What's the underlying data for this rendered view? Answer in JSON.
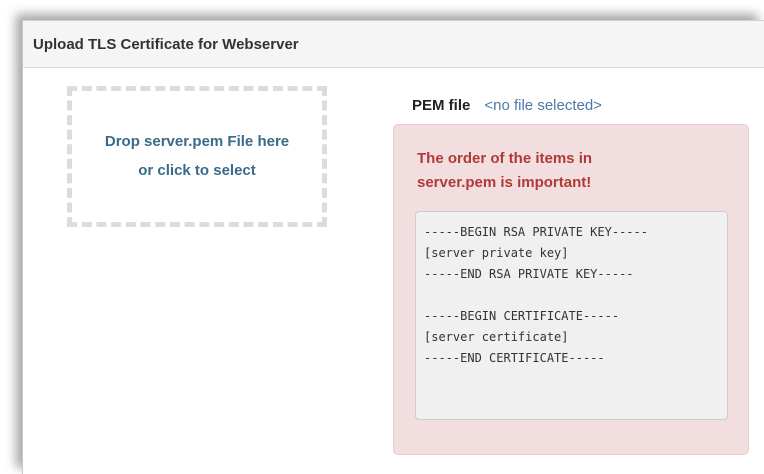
{
  "panel": {
    "title": "Upload TLS Certificate for Webserver"
  },
  "dropzone": {
    "line1": "Drop server.pem File here",
    "line2": "or click to select"
  },
  "pem_file": {
    "label": "PEM file",
    "value": "<no file selected>"
  },
  "alert": {
    "message": "The order of the items in server.pem is important!",
    "code_lines": [
      "-----BEGIN RSA PRIVATE KEY-----",
      "[server private key]",
      "-----END RSA PRIVATE KEY-----",
      "",
      "-----BEGIN CERTIFICATE-----",
      "[server certificate]",
      "-----END CERTIFICATE-----"
    ]
  },
  "colors": {
    "alert_background": "#f2dede",
    "alert_text": "#b03a37",
    "link_blue": "#3b6a8a"
  }
}
